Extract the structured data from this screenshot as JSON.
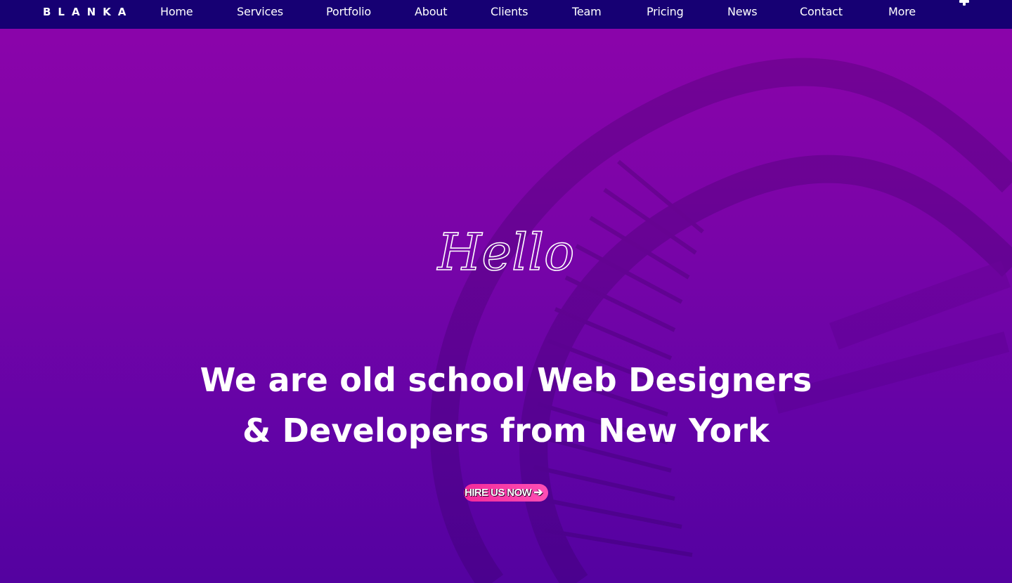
{
  "brand": {
    "logo": "BLANKA"
  },
  "nav": {
    "items": [
      {
        "label": "Home"
      },
      {
        "label": "Services"
      },
      {
        "label": "Portfolio"
      },
      {
        "label": "About"
      },
      {
        "label": "Clients"
      },
      {
        "label": "Team"
      },
      {
        "label": "Pricing"
      },
      {
        "label": "News"
      },
      {
        "label": "Contact"
      },
      {
        "label": "More"
      }
    ],
    "extra_icon": "plus-icon"
  },
  "hero": {
    "greeting": "Hello",
    "headline_line1": "We are old school Web Designers",
    "headline_line2": "& Developers from New York",
    "cta_label": "HIRE US NOW",
    "cta_icon": "arrow-right-icon"
  },
  "colors": {
    "topbar": "#160073",
    "background_top": "#8d04aa",
    "background_bottom": "#5402a0",
    "cta": "#f5299a",
    "text": "#ffffff"
  }
}
